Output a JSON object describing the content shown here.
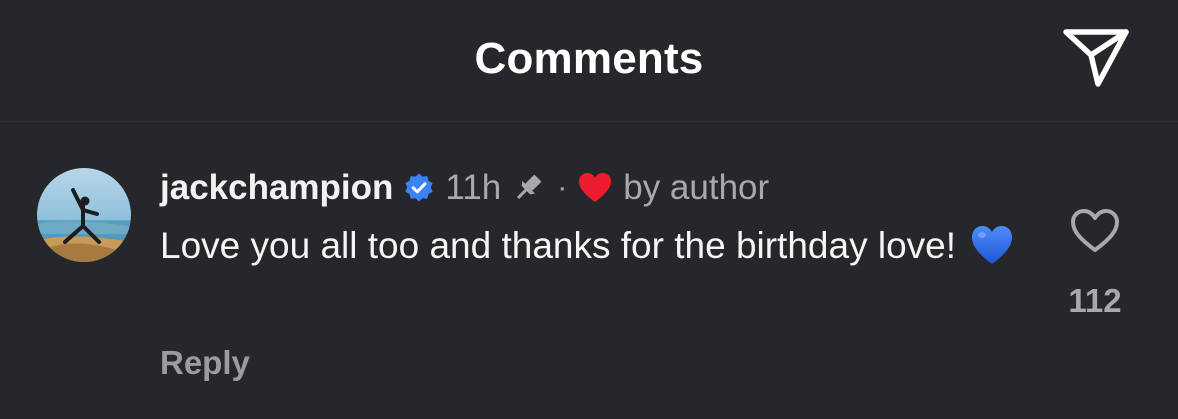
{
  "header": {
    "title": "Comments",
    "share_icon": "paper-plane-icon"
  },
  "comment": {
    "username": "jackchampion",
    "verified_icon": "verified-badge-icon",
    "timestamp": "11h",
    "pinned_icon": "pin-icon",
    "separator": "·",
    "author_heart_icon": "red-heart-icon",
    "liked_by_author_label": "by author",
    "text": "Love you all too and thanks for the birthday love!",
    "text_emoji": "blue-heart-icon",
    "reply_label": "Reply",
    "like_icon": "heart-outline-icon",
    "like_count": "112"
  },
  "colors": {
    "background": "#26272b",
    "verified": "#3b82f6",
    "author_heart": "#ed1c2e",
    "emoji_heart": "#2f6cf0",
    "muted_text": "#a8a8ad"
  }
}
